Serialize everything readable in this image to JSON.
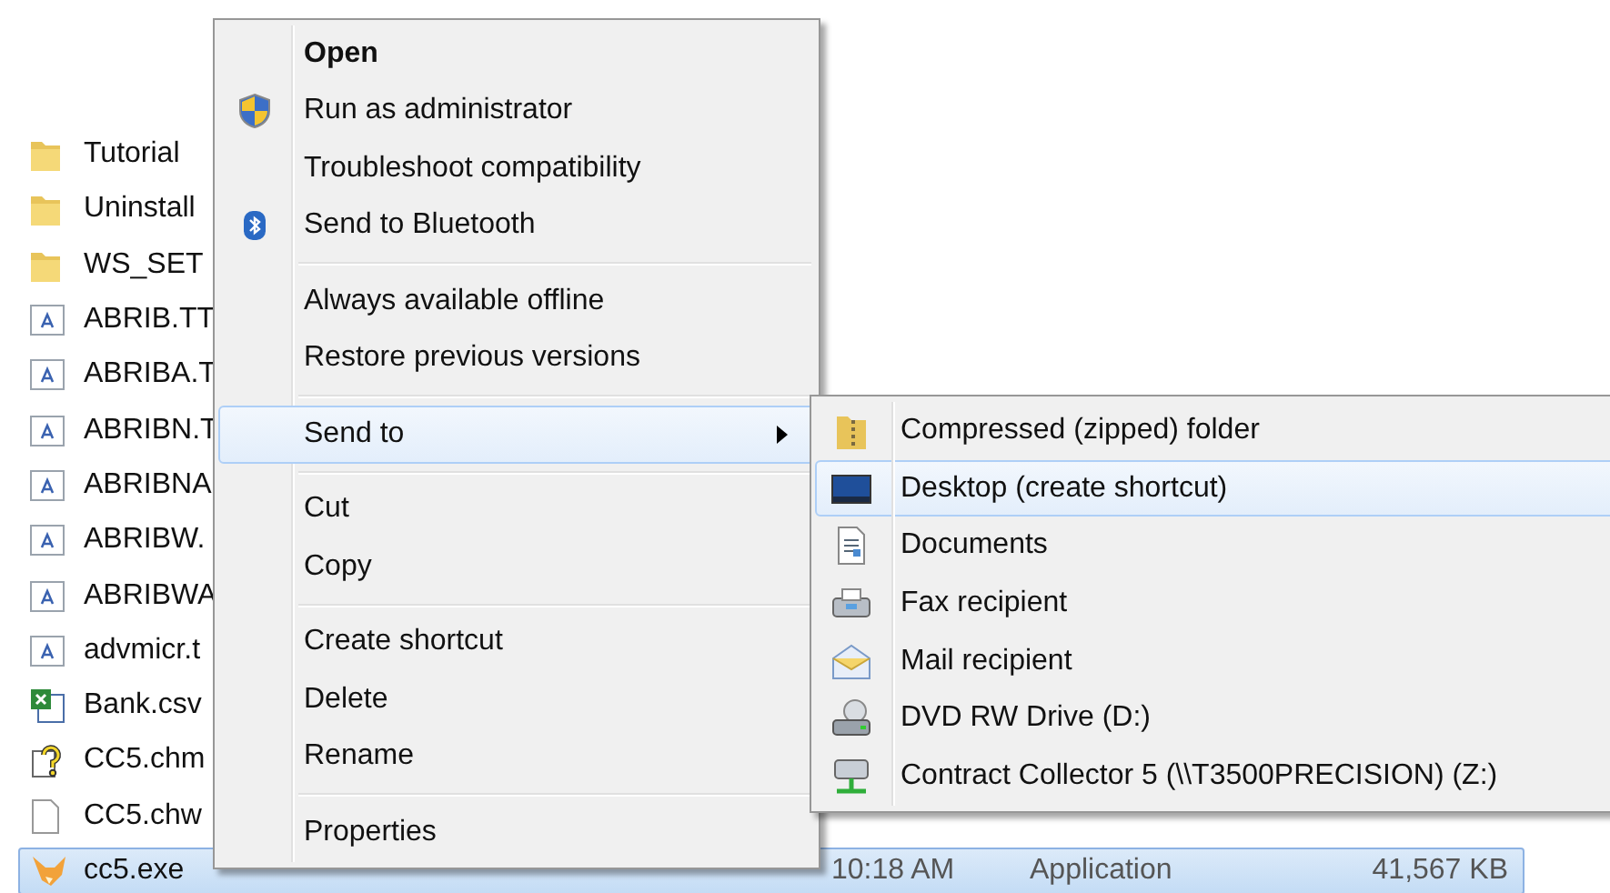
{
  "files": [
    {
      "name": "Tutorial",
      "kind": "folder",
      "selected": false
    },
    {
      "name": "Uninstall",
      "kind": "folder",
      "selected": false
    },
    {
      "name": "WS_SET",
      "kind": "folder",
      "selected": false
    },
    {
      "name": "ABRIB.TT",
      "kind": "font",
      "selected": false
    },
    {
      "name": "ABRIBA.T",
      "kind": "font",
      "selected": false
    },
    {
      "name": "ABRIBN.T",
      "kind": "font",
      "selected": false
    },
    {
      "name": "ABRIBNA",
      "kind": "font",
      "selected": false
    },
    {
      "name": "ABRIBW.",
      "kind": "font",
      "selected": false
    },
    {
      "name": "ABRIBWA",
      "kind": "font",
      "selected": false
    },
    {
      "name": "advmicr.t",
      "kind": "font",
      "selected": false
    },
    {
      "name": "Bank.csv",
      "kind": "sheet",
      "selected": false
    },
    {
      "name": "CC5.chm",
      "kind": "help",
      "selected": false
    },
    {
      "name": "CC5.chw",
      "kind": "blank",
      "selected": false
    },
    {
      "name": "cc5.exe",
      "kind": "app",
      "selected": true,
      "date": "10:18 AM",
      "type": "Application",
      "size": "41,567 KB"
    }
  ],
  "context_menu": {
    "groups": [
      [
        {
          "label": "Open",
          "kind": "default",
          "selected": false
        },
        {
          "label": "Run as administrator",
          "kind": "shield",
          "selected": false
        },
        {
          "label": "Troubleshoot compatibility",
          "kind": "plain",
          "selected": false
        },
        {
          "label": "Send to Bluetooth",
          "kind": "bluetooth",
          "selected": false
        }
      ],
      [
        {
          "label": "Always available offline",
          "kind": "plain",
          "selected": false
        },
        {
          "label": "Restore previous versions",
          "kind": "plain",
          "selected": false
        }
      ],
      [
        {
          "label": "Send to",
          "kind": "submenu",
          "selected": true
        }
      ],
      [
        {
          "label": "Cut",
          "kind": "plain",
          "selected": false
        },
        {
          "label": "Copy",
          "kind": "plain",
          "selected": false
        }
      ],
      [
        {
          "label": "Create shortcut",
          "kind": "plain",
          "selected": false
        },
        {
          "label": "Delete",
          "kind": "plain",
          "selected": false
        },
        {
          "label": "Rename",
          "kind": "plain",
          "selected": false
        }
      ],
      [
        {
          "label": "Properties",
          "kind": "plain",
          "selected": false
        }
      ]
    ]
  },
  "send_to_menu": {
    "items": [
      {
        "label": "Compressed (zipped) folder",
        "kind": "zip",
        "selected": false
      },
      {
        "label": "Desktop (create shortcut)",
        "kind": "desktop",
        "selected": true
      },
      {
        "label": "Documents",
        "kind": "document",
        "selected": false
      },
      {
        "label": "Fax recipient",
        "kind": "fax",
        "selected": false
      },
      {
        "label": "Mail recipient",
        "kind": "mail",
        "selected": false
      },
      {
        "label": "DVD RW Drive (D:)",
        "kind": "drive",
        "selected": false
      },
      {
        "label": "Contract Collector 5 (\\\\T3500PRECISION) (Z:)",
        "kind": "network",
        "selected": false
      }
    ]
  }
}
